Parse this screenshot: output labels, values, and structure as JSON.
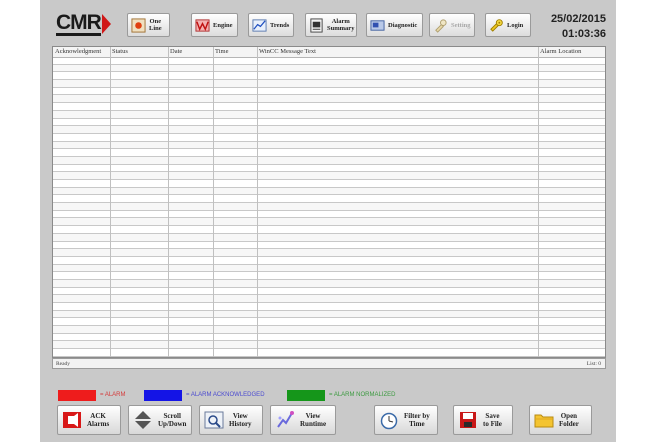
{
  "header": {
    "logo_text": "CMR",
    "date": "25/02/2015",
    "time": "01:03:36",
    "nav": [
      {
        "label": "One\nLine",
        "icon": "one-line-icon"
      },
      {
        "label": "Engine",
        "icon": "engine-icon"
      },
      {
        "label": "Trends",
        "icon": "trend-icon"
      },
      {
        "label": "Alarm\nSummary",
        "icon": "alarm-summary-icon"
      },
      {
        "label": "Diagnostic",
        "icon": "diagnostic-icon"
      },
      {
        "label": "Setting",
        "icon": "setting-icon",
        "disabled": true
      },
      {
        "label": "Login",
        "icon": "login-icon"
      }
    ]
  },
  "table": {
    "columns": [
      "Acknowledgment",
      "Status",
      "Date",
      "Time",
      "WinCC Message Text",
      "Alarm Location"
    ],
    "rows": []
  },
  "statusbar": {
    "left": "Ready",
    "right": "List: 0"
  },
  "legend": [
    {
      "label": "= ALARM",
      "color": "#ee1c1c",
      "text_color": "#d43a3a"
    },
    {
      "label": "= ALARM ACKNOWLEDGED",
      "color": "#1414e6",
      "text_color": "#4a4ad0"
    },
    {
      "label": "= ALARM NORMALIZED",
      "color": "#15961a",
      "text_color": "#3c9a40"
    }
  ],
  "actions": [
    {
      "label": "ACK\nAlarms",
      "icon": "ack-alarm-icon"
    },
    {
      "label": "Scroll\nUp/Down",
      "icon": "scroll-arrows-icon"
    },
    {
      "label": "View\nHistory",
      "icon": "view-history-icon"
    },
    {
      "label": "View\nRuntime",
      "icon": "view-runtime-icon"
    },
    {
      "label": "Filter by\nTime",
      "icon": "clock-icon"
    },
    {
      "label": "Save\nto File",
      "icon": "save-disk-icon"
    },
    {
      "label": "Open\nFolder",
      "icon": "folder-icon"
    }
  ]
}
